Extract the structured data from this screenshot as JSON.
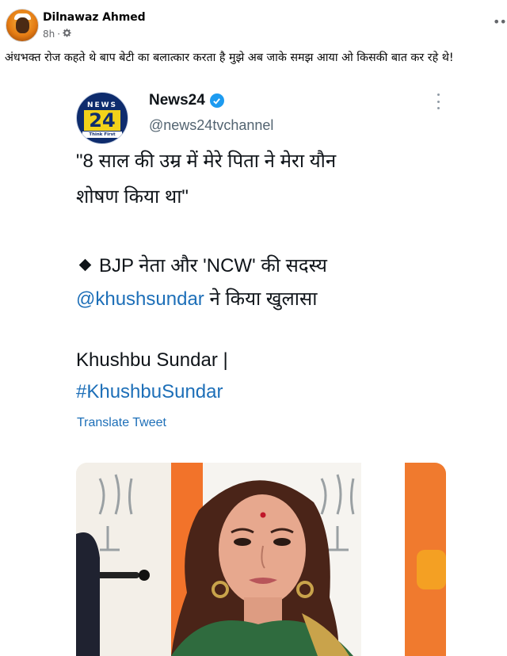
{
  "post": {
    "author": "Dilnawaz Ahmed",
    "time": "8h",
    "privacy_icon": "gear-icon",
    "more_icon": "ellipsis-icon",
    "text": "अंधभक्त रोज कहते थे बाप बेटी का बलात्कार करता है मुझे अब जाके समझ आया ओ किसकी बात कर रहे थे!"
  },
  "tweet": {
    "logo": {
      "top": "NEWS",
      "number": "24",
      "tagline": "Think First"
    },
    "display_name": "News24",
    "handle": "@news24tvchannel",
    "quote_line1": "\"8 साल की उम्र में मेरे पिता ने मेरा यौन",
    "quote_line2": "शोषण किया था\"",
    "bullet_text": "BJP नेता और 'NCW' की सदस्य",
    "mention": "@khushsundar",
    "mention_suffix": " ने किया खुलासा",
    "name_line": "Khushbu Sundar |",
    "hashtag": "#KhushbuSundar",
    "translate_label": "Translate Tweet"
  },
  "colors": {
    "link": "#1d6fb8",
    "verified": "#1d9bf0",
    "logo_navy": "#0e2c6d",
    "logo_yellow": "#f2d21a",
    "bjp_orange": "#f2732a",
    "saree_green": "#2f6b3e"
  }
}
